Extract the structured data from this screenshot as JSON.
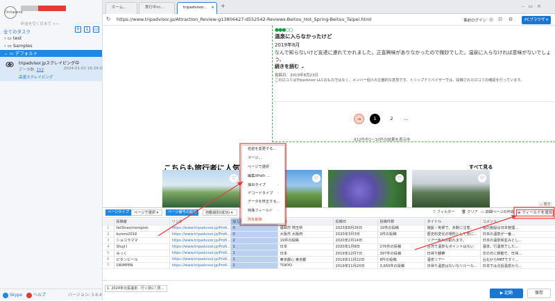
{
  "sidebar": {
    "logo": "Octoparse",
    "user_sub": "料金を引く日まで >>",
    "tasks_title": "全てのタスク",
    "tree": [
      "test",
      "Samples",
      "デフォルト"
    ],
    "task": {
      "title": "tripadvisor.jpスクレイピング中",
      "meta_label": "データ数:",
      "meta_count": "112",
      "meta_time": "2024-01-02 16:34:25",
      "action": "高速スクレイピング"
    },
    "footer": {
      "skype": "Skype",
      "help": "ヘルプ",
      "version": "バージョン: 3.6.4"
    }
  },
  "browser": {
    "tabs": [
      "ホーム...",
      "実行中tri...",
      "tripadvisor..."
    ],
    "url": "https://www.tripadvisor.jp/Attraction_Review-g13806427-d552542-Reviews-Beitou_Hot_Spring-Beitou_Taipei.html",
    "login": "事前ログイン",
    "pc_button": "PCブラウザ"
  },
  "review": {
    "title": "温泉に入らなかったけど",
    "date": "2019年8月",
    "text": "なんで知らないけど友達に連れてかれました。正直興味がありなかったので微妙でした。温泉に入らなければ意味がないでしょう。",
    "read_more": "続きを読む ⌄",
    "post_date": "投稿日：2019年8月23日",
    "disclaimer": "この口コミはTripadvisor LLCのものではなく、メンバー個人の主観的な意見です。トリップアドバイザーでは、投稿された口コミの確認を行っています。",
    "rating": 2
  },
  "pagination": {
    "page1": "1",
    "page2": "2",
    "more": "…",
    "results": "912件中1〜10件の結果を表示中"
  },
  "section": {
    "title": "こちらも旅行者に人気",
    "see_all": "すべて見る"
  },
  "context_menu": [
    "名前を変更する...",
    "マージ...",
    "ページで選択",
    "編集XPath ...",
    "抽出タイプ",
    "デコードタイプ",
    "データを修正する...",
    "特殊フィールド",
    "列を削除"
  ],
  "table_toolbar": {
    "page_type": "ページタイプ",
    "page_select": "ページで選択",
    "page_num": "ページ番号の設定",
    "auto_detect": "自動識別(成功)",
    "filter": "フィルター",
    "clear": "クリア",
    "detail": "詳細ページの作成",
    "add_field": "フィールドを追加",
    "hide": "隠す"
  },
  "table": {
    "headers": [
      "",
      "投稿者",
      "リンク",
      "いいね数",
      "住所",
      "投稿日",
      "投稿件数",
      "タイトル",
      "コメント"
    ],
    "rows": [
      [
        "1",
        "fat3travchampion",
        "https://www.tripadvisor.jp/Profi...",
        "0",
        "福岡市 埼玉県",
        "2023年8月26日",
        "19件の投稿",
        "施設・気候で、多数に注意。",
        "施の施設は日本管理..."
      ],
      [
        "2",
        "kuroro2019",
        "https://www.tripadvisor.jp/Profi...",
        "0",
        "大阪市 大阪府",
        "2020年3月3日",
        "2件の投稿",
        "歴史的変化の場所として見に...",
        "日本の温泉が一番..."
      ],
      [
        "3",
        "ショコラママ",
        "https://www.tripadvisor.jp/Profi...",
        "2",
        "19件の投稿",
        "2020年2月14日",
        "",
        "ツアー後れの勤れます。",
        "日本の温泉街並みとし..."
      ],
      [
        "4",
        "Shuji I",
        "https://www.tripadvisor.jp/Profi...",
        "1",
        "日本",
        "2020年1月8日",
        "276件の投稿",
        "台湾で温泉もポイントはない",
        "温泉、行温泉でした..."
      ],
      [
        "5",
        "みっく",
        "https://www.tripadvisor.jp/Profi...",
        "1",
        "日本",
        "2019年12月7日",
        "397件の投稿",
        "日帰り観察",
        "次の日に移動で、日帰..."
      ],
      [
        "6",
        "ピタンビール",
        "https://www.tripadvisor.jp/Profi...",
        "1",
        "東京都心 東京都",
        "2019年11月22日",
        "8件の投稿",
        "温泉ツアー",
        "台北からMRTですぐ..."
      ],
      [
        "7",
        "ORIMPEN",
        "https://www.tripadvisor.jp/Profi...",
        "2",
        "TOKYO",
        "2019年11月20日",
        "3,650件の投稿",
        "日帰り温泉はないなリルール...",
        "日本では北投温泉から..."
      ]
    ]
  },
  "bottom": {
    "current_step": "1. 2024年北投温泉 - 行く前に! 見...",
    "run": "▶ 起動",
    "save": "保存"
  }
}
